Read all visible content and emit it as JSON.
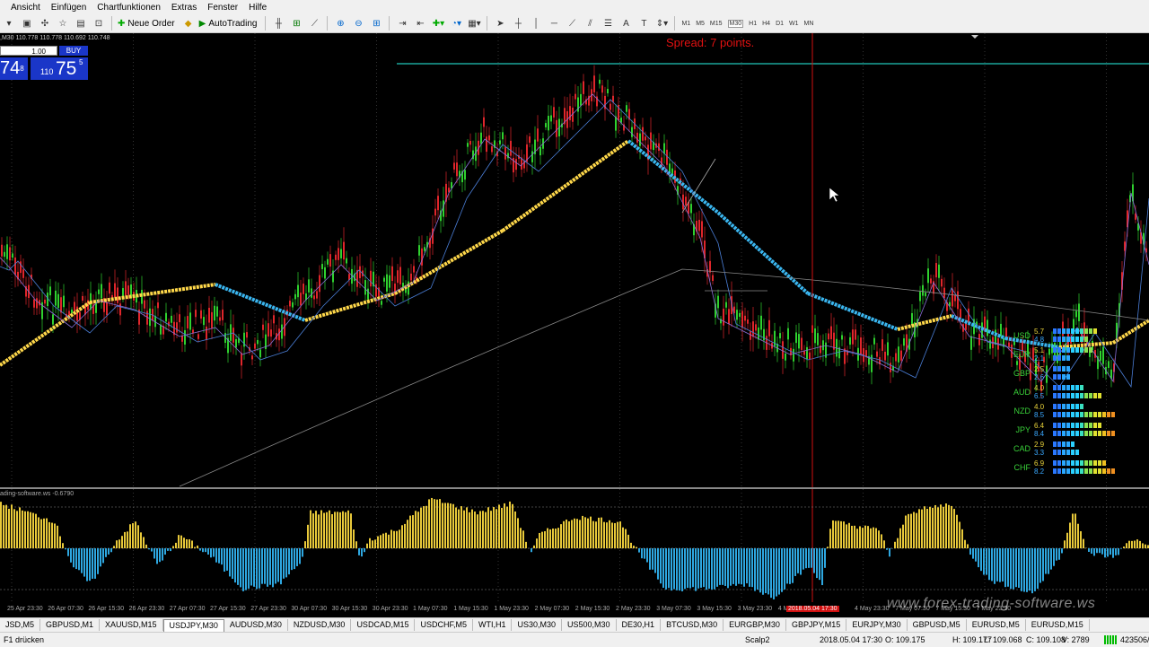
{
  "menu": [
    "Ansicht",
    "Einfügen",
    "Chartfunktionen",
    "Extras",
    "Fenster",
    "Hilfe"
  ],
  "toolbar": {
    "new_order": "Neue Order",
    "autotrading": "AutoTrading",
    "timeframes": [
      "M1",
      "M5",
      "M15",
      "M30",
      "H1",
      "H4",
      "D1",
      "W1",
      "MN"
    ],
    "selected_timeframe": "M30"
  },
  "chart": {
    "info": ",M30 110.778 110.778 110.692 110.748",
    "spread": "Spread: 7 points.",
    "one_click": {
      "sell_label": "",
      "lot": "1.00",
      "buy_label": "BUY",
      "sell_price": "74",
      "sell_sup": "8",
      "buy_small": "110",
      "buy_big": "75",
      "buy_sup": "5"
    },
    "oscillator_label": "ading-software.ws -0.6790",
    "colors": {
      "bull": "#2fd12f",
      "bear": "#e0262b",
      "ma_slow": "#ffd84a",
      "ma_fast": "#3ab6f0",
      "osc_pos": "#e8c93a",
      "osc_neg": "#2ea7e0",
      "level": "#1aa59a",
      "vline": "#d01010"
    }
  },
  "currency_strength": [
    {
      "currency": "USD",
      "v1": "5.7",
      "v2": "4.8"
    },
    {
      "currency": "EUR",
      "v1": "5.1",
      "v2": "2.1"
    },
    {
      "currency": "GBP",
      "v1": "2.5",
      "v2": "2.6"
    },
    {
      "currency": "AUD",
      "v1": "4.0",
      "v2": "6.5"
    },
    {
      "currency": "NZD",
      "v1": "4.0",
      "v2": "8.5"
    },
    {
      "currency": "JPY",
      "v1": "6.4",
      "v2": "8.4"
    },
    {
      "currency": "CAD",
      "v1": "2.9",
      "v2": "3.3"
    },
    {
      "currency": "CHF",
      "v1": "6.9",
      "v2": "8.2"
    }
  ],
  "time_axis": [
    "25 Apr 23:30",
    "26 Apr 07:30",
    "26 Apr 15:30",
    "26 Apr 23:30",
    "27 Apr 07:30",
    "27 Apr 15:30",
    "27 Apr 23:30",
    "30 Apr 07:30",
    "30 Apr 15:30",
    "30 Apr 23:30",
    "1 May 07:30",
    "1 May 15:30",
    "1 May 23:30",
    "2 May 07:30",
    "2 May 15:30",
    "2 May 23:30",
    "3 May 07:30",
    "3 May 15:30",
    "3 May 23:30",
    "4 May 07:30",
    "2018.05.04 17:30",
    "4 May 23:30",
    "7 May 07:30",
    "7 May 15:30",
    "7 May 23:30"
  ],
  "watermark": "www.forex-trading-software.ws",
  "tabs": [
    "JSD,M5",
    "GBPUSD,M1",
    "XAUUSD,M15",
    "USDJPY,M30",
    "AUDUSD,M30",
    "NZDUSD,M30",
    "USDCAD,M15",
    "USDCHF,M5",
    "WTI,H1",
    "US30,M30",
    "US500,M30",
    "DE30,H1",
    "BTCUSD,M30",
    "EURGBP,M30",
    "GBPJPY,M15",
    "EURJPY,M30",
    "GBPUSD,M5",
    "EURUSD,M5",
    "EURUSD,M15"
  ],
  "active_tab": "USDJPY,M30",
  "status": {
    "help": "F1 drücken",
    "profile": "Scalp2",
    "datetime": "2018.05.04 17:30",
    "open": "O: 109.175",
    "high": "H: 109.177",
    "low": "L: 109.068",
    "close": "C: 109.108",
    "volume": "V: 2789",
    "traffic": "423506/"
  }
}
